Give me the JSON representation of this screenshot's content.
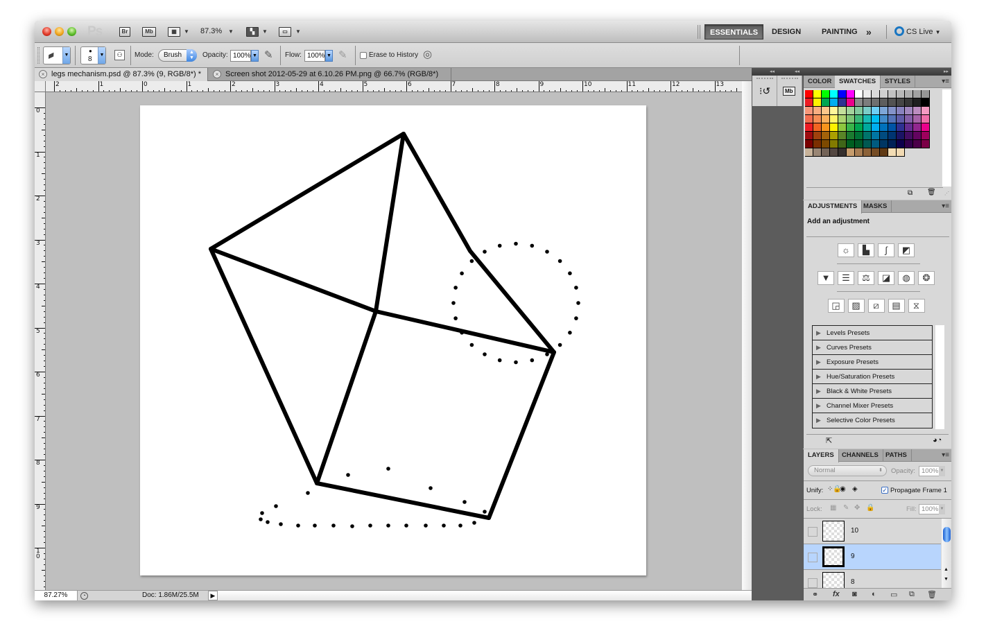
{
  "app": {
    "logo": "Ps",
    "bridge_label": "Br",
    "minibridge_label": "Mb",
    "zoom_level": "87.3%",
    "workspaces": [
      {
        "label": "ESSENTIALS",
        "active": true
      },
      {
        "label": "DESIGN",
        "active": false
      },
      {
        "label": "PAINTING",
        "active": false
      }
    ],
    "workspace_overflow": "»",
    "cs_live": "CS Live"
  },
  "options_bar": {
    "brush_size": "8",
    "mode_label": "Mode:",
    "mode_value": "Brush",
    "opacity_label": "Opacity:",
    "opacity_value": "100%",
    "flow_label": "Flow:",
    "flow_value": "100%",
    "erase_to_history_label": "Erase to History",
    "erase_to_history_checked": false
  },
  "documents": [
    {
      "title": "legs mechanism.psd @ 87.3% (9, RGB/8*) *",
      "active": true
    },
    {
      "title": "Screen shot 2012-05-29 at 6.10.26 PM.png @ 66.7% (RGB/8*)",
      "active": false
    }
  ],
  "rulers": {
    "horizontal": [
      "2",
      "1",
      "0",
      "1",
      "2",
      "3",
      "4",
      "5",
      "6",
      "7",
      "8",
      "9",
      "10",
      "11",
      "12",
      "13"
    ],
    "vertical": [
      "0",
      "1",
      "2",
      "3",
      "4",
      "5",
      "6",
      "7",
      "8",
      "9",
      "10",
      "1"
    ]
  },
  "status_bar": {
    "zoom": "87.27%",
    "doc_info": "Doc: 1.86M/25.5M"
  },
  "swatches_panel": {
    "tabs": [
      {
        "label": "COLOR",
        "active": false
      },
      {
        "label": "SWATCHES",
        "active": true
      },
      {
        "label": "STYLES",
        "active": false
      }
    ],
    "rows": [
      [
        "#ff0000",
        "#ffff00",
        "#00ff00",
        "#00ffff",
        "#0000ff",
        "#ff00ff",
        "#ffffff",
        "#ebebeb",
        "#d9d9d9",
        "#cfcfcf",
        "#c2c2c2",
        "#b8b8b8",
        "#adadad",
        "#a1a1a1",
        "#969696"
      ],
      [
        "#ed1c24",
        "#fff200",
        "#00a651",
        "#00aeef",
        "#2e3192",
        "#ec008c",
        "#898989",
        "#7d7d7d",
        "#6f6f6f",
        "#5e5e5e",
        "#525252",
        "#464646",
        "#363636",
        "#1f1f1f",
        "#000000"
      ],
      [
        "#f7977a",
        "#f9ad81",
        "#fdc68a",
        "#fff79a",
        "#c4df9b",
        "#a3d39c",
        "#82ca9d",
        "#7bcdc8",
        "#6ecff6",
        "#7ea7d8",
        "#8493ca",
        "#8882be",
        "#a187be",
        "#bc8cbf",
        "#f49ac2"
      ],
      [
        "#f26c4f",
        "#f68e55",
        "#fbaf5c",
        "#fff467",
        "#acd372",
        "#7cc576",
        "#3bb878",
        "#1abbb4",
        "#00bff3",
        "#438cca",
        "#5574b9",
        "#605ca8",
        "#855fa8",
        "#a763a8",
        "#f06ea9"
      ],
      [
        "#ed1c24",
        "#f26522",
        "#f7941d",
        "#fff200",
        "#8dc73f",
        "#39b54a",
        "#00a651",
        "#00a99d",
        "#00aeef",
        "#0072bc",
        "#0054a6",
        "#2e3192",
        "#662d91",
        "#92278f",
        "#ec008c"
      ],
      [
        "#9e0b0f",
        "#a0410d",
        "#a3620a",
        "#aba000",
        "#598527",
        "#1a7b30",
        "#007236",
        "#00746b",
        "#0076a3",
        "#004b80",
        "#003471",
        "#1b1464",
        "#440e62",
        "#630460",
        "#9e005d"
      ],
      [
        "#790000",
        "#7b2e00",
        "#7d4900",
        "#827b00",
        "#406618",
        "#005e20",
        "#005826",
        "#005952",
        "#005b7f",
        "#003663",
        "#002157",
        "#0d004c",
        "#32004b",
        "#4b0049",
        "#7b0046"
      ],
      [
        "#c7b299",
        "#998675",
        "#736357",
        "#534741",
        "#362f2d",
        "#c69c6d",
        "#a67c52",
        "#8c6239",
        "#754c24",
        "#603913",
        "#f2dcb4",
        "#f1dab3"
      ]
    ]
  },
  "adjustments_panel": {
    "tabs": [
      {
        "label": "ADJUSTMENTS",
        "active": true
      },
      {
        "label": "MASKS",
        "active": false
      }
    ],
    "title": "Add an adjustment",
    "icon_rows": [
      [
        "brightness-contrast",
        "levels",
        "curves",
        "exposure"
      ],
      [
        "vibrance",
        "hue-saturation",
        "color-balance",
        "black-white",
        "photo-filter",
        "channel-mixer"
      ],
      [
        "invert",
        "posterize",
        "threshold",
        "gradient-map",
        "selective-color"
      ]
    ],
    "presets": [
      "Levels Presets",
      "Curves Presets",
      "Exposure Presets",
      "Hue/Saturation Presets",
      "Black & White Presets",
      "Channel Mixer Presets",
      "Selective Color Presets"
    ]
  },
  "layers_panel": {
    "tabs": [
      {
        "label": "LAYERS",
        "active": true
      },
      {
        "label": "CHANNELS",
        "active": false
      },
      {
        "label": "PATHS",
        "active": false
      }
    ],
    "blend_mode": "Normal",
    "opacity_label": "Opacity:",
    "opacity_value": "100%",
    "unify_label": "Unify:",
    "propagate_label": "Propagate Frame 1",
    "propagate_checked": true,
    "lock_label": "Lock:",
    "fill_label": "Fill:",
    "fill_value": "100%",
    "layers": [
      {
        "name": "10",
        "selected": false
      },
      {
        "name": "9",
        "selected": true
      },
      {
        "name": "8",
        "selected": false
      }
    ]
  }
}
